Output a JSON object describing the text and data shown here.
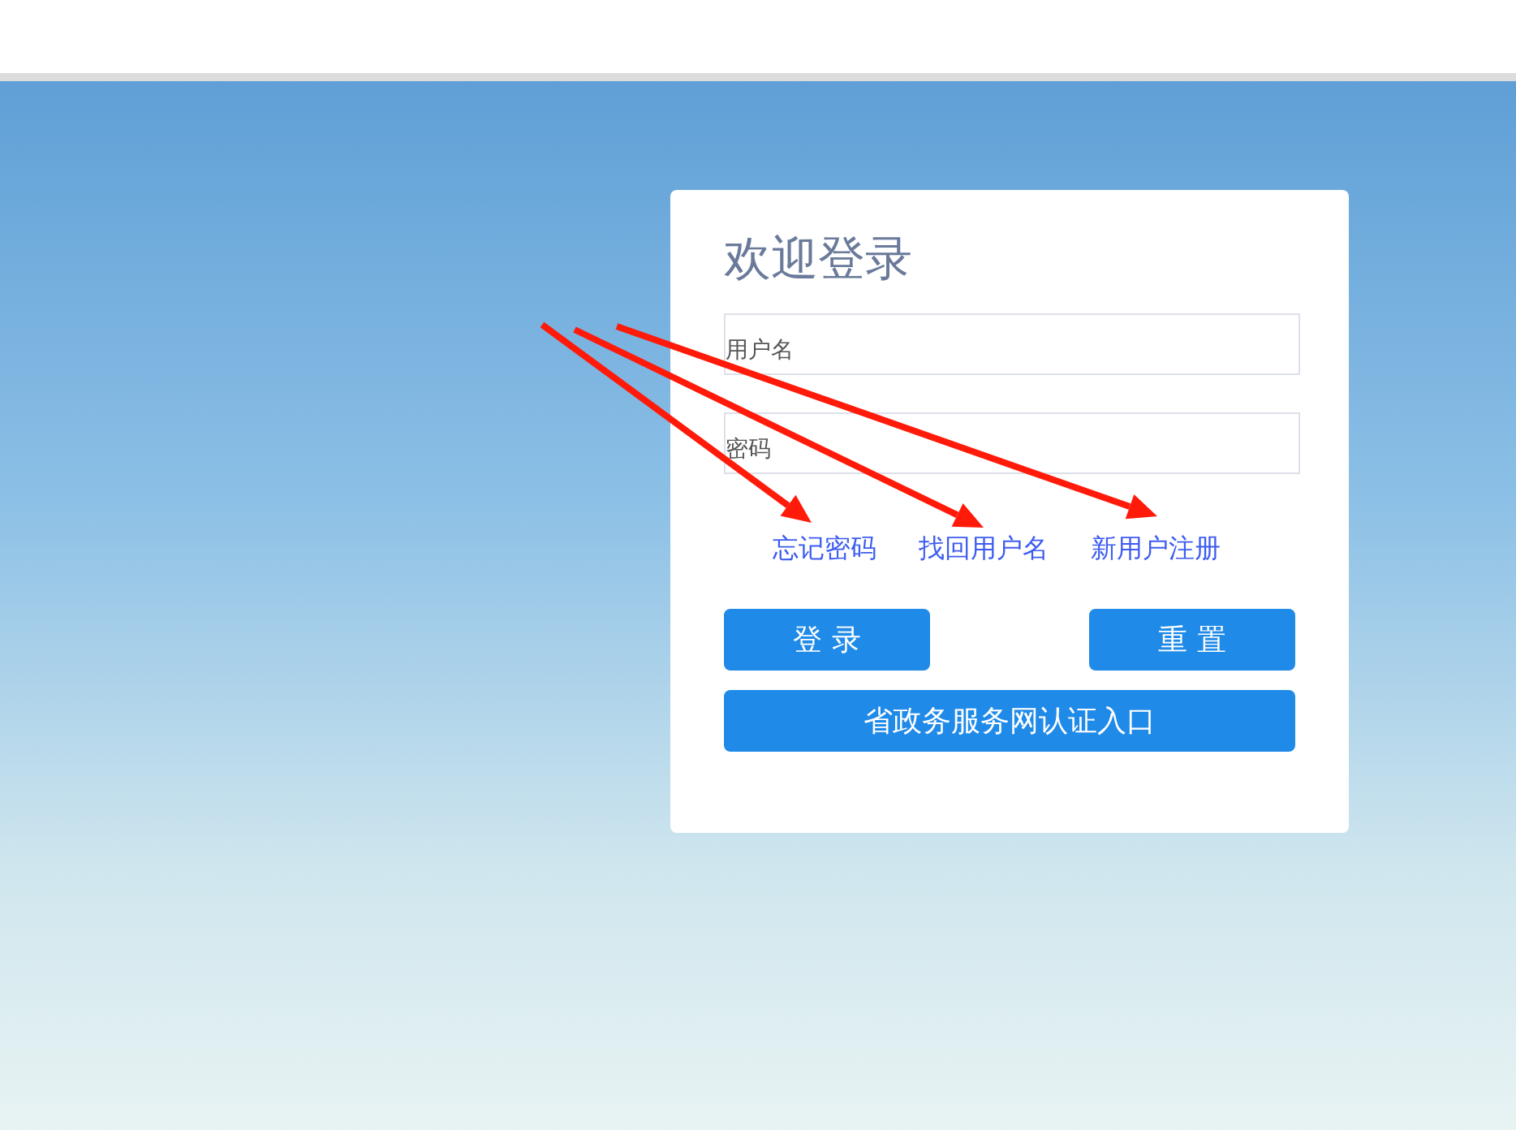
{
  "login_card": {
    "title": "欢迎登录",
    "fields": [
      {
        "placeholder": "用户名"
      },
      {
        "placeholder": "密码"
      }
    ],
    "links": [
      "忘记密码",
      "找回用户名",
      "新用户注册"
    ],
    "buttons": [
      "登 录",
      "重 置"
    ],
    "wide_button": "省政务服务网认证入口"
  }
}
